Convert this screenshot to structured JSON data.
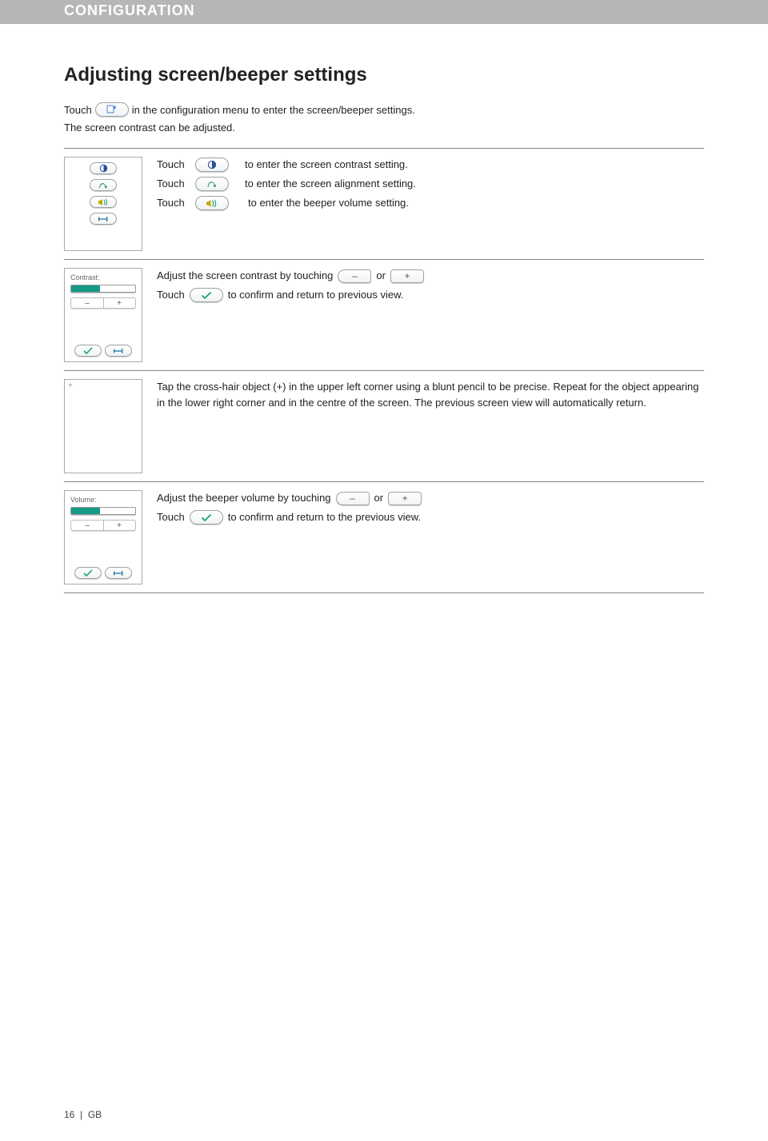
{
  "header": {
    "title": "CONFIGURATION"
  },
  "page": {
    "h1": "Adjusting screen/beeper settings",
    "intro_a": "Touch",
    "intro_b": "in the configuration menu to enter the screen/beeper settings.",
    "intro2": "The screen contrast can be adjusted."
  },
  "row1": {
    "t": "Touch",
    "l1": "to enter the screen contrast setting.",
    "l2": "to enter the screen alignment setting.",
    "l3": "to enter the beeper volume setting."
  },
  "row2": {
    "screen_label": "Contrast:",
    "line1_a": "Adjust the screen contrast by touching",
    "or": "or",
    "line2_a": "Touch",
    "line2_b": "to confirm and return to previous view."
  },
  "row3": {
    "text": "Tap the cross-hair object (+) in the upper left corner using a blunt pencil to be precise. Repeat for the object appearing in the lower right corner and in the centre of the screen. The previous screen view will automatically return."
  },
  "row4": {
    "screen_label": "Volume:",
    "line1_a": "Adjust the beeper volume by touching",
    "or": "or",
    "line2_a": "Touch",
    "line2_b": "to confirm and return to the previous view."
  },
  "glyphs": {
    "minus": "–",
    "plus": "+"
  },
  "footer": {
    "page": "16",
    "sep": "|",
    "locale": "GB"
  }
}
